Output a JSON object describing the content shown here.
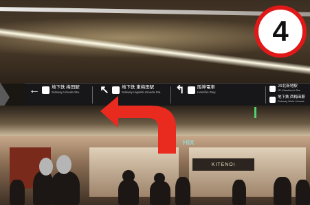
{
  "badge": {
    "number": "4",
    "ring_color": "#e11818"
  },
  "signboard": {
    "segments": [
      {
        "arrow": "←",
        "arrow_icon": "arrow-left-icon",
        "main": "地下鉄 梅田駅",
        "sub": "Subway Umeda Sta."
      },
      {
        "arrow": "↖",
        "arrow_icon": "arrow-up-left-icon",
        "main": "地下鉄 東梅田駅",
        "sub": "Subway Higashi-Umeda Sta."
      },
      {
        "arrow": "↰",
        "arrow_icon": "arrow-turn-icon",
        "main": "阪神電車",
        "sub": "Hanshin Rwy."
      },
      {
        "arrow": "",
        "arrow_icon": "",
        "main": "JR北新地駅",
        "sub": "JR Kitashinchi Sta."
      },
      {
        "arrow": "",
        "arrow_icon": "",
        "main": "地下鉄 西梅田駅",
        "sub": "Subway Nishi-Umeda"
      }
    ]
  },
  "shops": {
    "hix": "HIX",
    "store_sign": "KITENOi"
  },
  "overlay": {
    "arrow_color": "#e82a1f"
  }
}
